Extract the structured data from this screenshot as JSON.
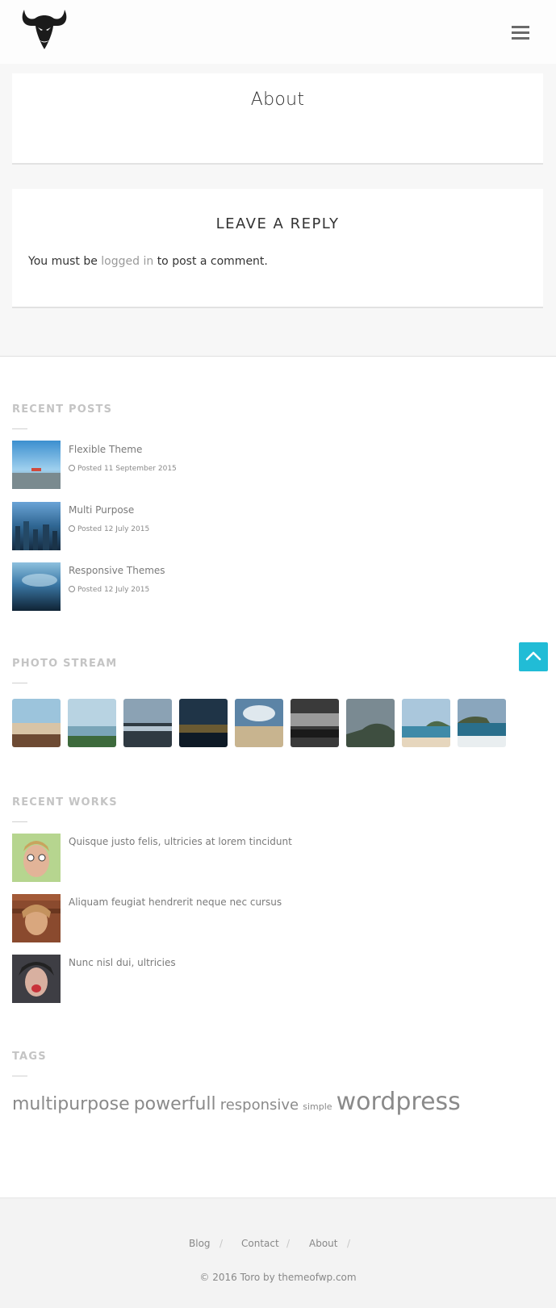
{
  "header": {
    "logo_alt": "bull head logo",
    "menu_icon": "hamburger-menu-icon"
  },
  "page": {
    "title": "About"
  },
  "reply": {
    "title": "LEAVE A REPLY",
    "text_before": "You must be",
    "link": "logged in",
    "text_after": "to post a comment."
  },
  "recent_posts": {
    "title": "RECENT POSTS",
    "items": [
      {
        "title": "Flexible Theme",
        "date": "Posted 11 September 2015"
      },
      {
        "title": "Multi Purpose",
        "date": "Posted 12 July 2015"
      },
      {
        "title": "Responsive Themes",
        "date": "Posted 12 July 2015"
      }
    ]
  },
  "photo_stream": {
    "title": "PHOTO STREAM",
    "count": 9
  },
  "recent_works": {
    "title": "RECENT WORKS",
    "items": [
      {
        "title": "Quisque justo felis, ultricies at lorem tincidunt"
      },
      {
        "title": "Aliquam feugiat hendrerit neque nec cursus"
      },
      {
        "title": "Nunc nisl dui, ultricies"
      }
    ]
  },
  "tags": {
    "title": "TAGS",
    "items": [
      "multipurpose",
      "powerfull",
      "responsive",
      "simple",
      "wordpress"
    ]
  },
  "footer": {
    "nav": [
      "Blog",
      "Contact",
      "About"
    ],
    "separator": "/",
    "copyright": "© 2016 Toro by themeofwp.com"
  },
  "colors": {
    "accent": "#21bcd6",
    "widget_title": "#c4c4c4",
    "footer_bg": "#f3f3f3"
  }
}
